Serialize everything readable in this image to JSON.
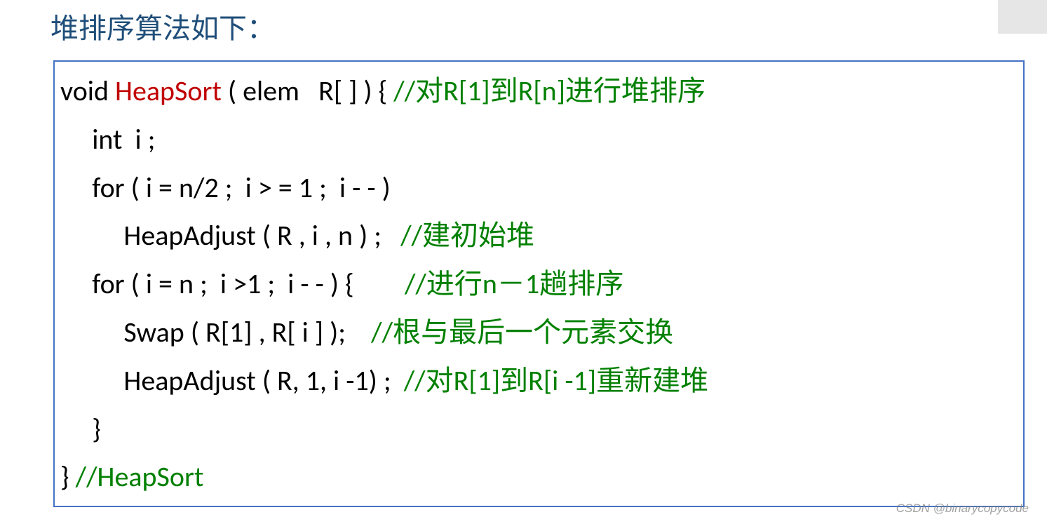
{
  "title": "堆排序算法如下：",
  "code": {
    "l1a": "void ",
    "l1b": "HeapSort",
    "l1c": " ( elem   R[ ] ) { ",
    "l1d": "//对R[1]到R[n]进行堆排序",
    "l2": "     int  i ;",
    "l3": "     for ( i = n/2 ;  i > = 1 ;  i - - )",
    "l4a": "          HeapAdjust ( R , i , n ) ;   ",
    "l4b": "//建初始堆",
    "l5a": "     for ( i = n ;  i >1 ;  i - - ) {        ",
    "l5b": "//进行n－1趟排序",
    "l6a": "          Swap ( R[1] , R[ i ] );    ",
    "l6b": "//根与最后一个元素交换",
    "l7a": "          HeapAdjust ( R, 1, i -1) ;  ",
    "l7b": "//对R[1]到R[i -1]重新建堆",
    "l8": "     }",
    "l9a": "} ",
    "l9b": "//HeapSort"
  },
  "watermark": "CSDN @binarycopycode"
}
